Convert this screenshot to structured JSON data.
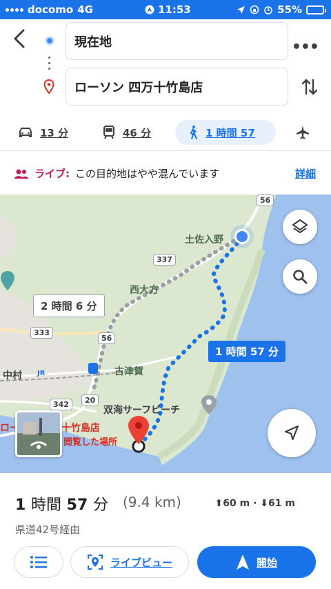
{
  "status_bar": {
    "carrier": "docomo",
    "network": "4G",
    "time": "11:53",
    "battery": "55%",
    "battery_level": 0.55
  },
  "header": {
    "origin": "現在地",
    "destination": "ローソン 四万十竹島店"
  },
  "modes": {
    "car": {
      "label": "13 分",
      "icon": "car-icon"
    },
    "transit": {
      "label": "46 分",
      "icon": "train-icon"
    },
    "walk": {
      "label": "1 時間 57",
      "icon": "walk-icon"
    },
    "flight": {
      "icon": "airplane-icon"
    }
  },
  "live_info": {
    "tag": "ライブ",
    "colon": ":",
    "text": "この目的地はやや混んでいます",
    "detail_link": "詳細"
  },
  "map": {
    "labels": {
      "tosairino": "土佐入野",
      "nishiogata": "西大方",
      "kotsuka": "古津賀",
      "nakamura": "中村",
      "soukai": "双海サーフビーチ",
      "dest_name": "ローソン 四万十竹島店",
      "recent": "閲覧した場所",
      "jr": "JR"
    },
    "shields": [
      "56",
      "337",
      "333",
      "56",
      "20",
      "342"
    ],
    "route_pills": {
      "alt": "2 時間 6 分",
      "main": "1 時間 57 分"
    }
  },
  "summary": {
    "duration_value1": "1",
    "duration_unit1": "時間",
    "duration_value2": "57",
    "duration_unit2": "分",
    "distance": "(9.4 km)",
    "elevation": "⬆60 m · ⬇61 m",
    "via": "県道42号経由"
  },
  "actions": {
    "live_view": "ライブビュー",
    "start": "開始"
  },
  "colors": {
    "accent": "#1a73e8",
    "live_tag": "#c2185b"
  }
}
